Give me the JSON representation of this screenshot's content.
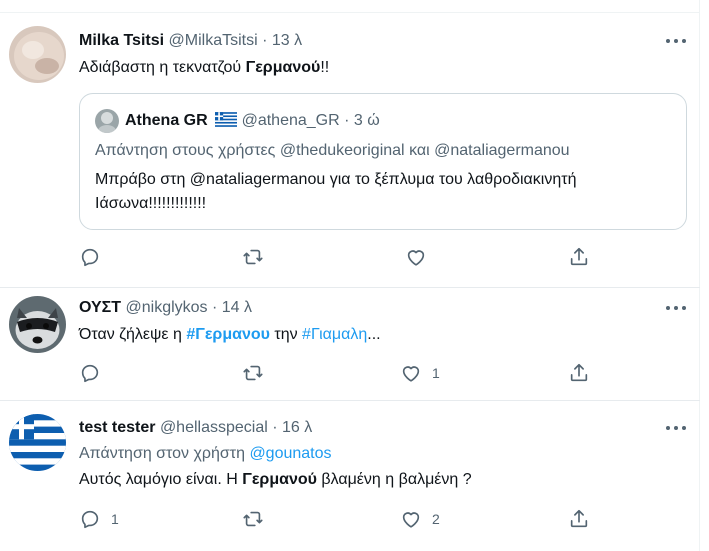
{
  "tweets": [
    {
      "name": "Milka Tsitsi",
      "handle": "@MilkaTsitsi",
      "sep": "·",
      "time": "13 λ",
      "text_before": "Αδιάβαστη η τεκνατζού ",
      "text_bold": "Γερμανού",
      "text_after": "!!",
      "quote": {
        "name": "Athena GR",
        "flag": "greek-flag",
        "handle": "@athena_GR",
        "sep": "·",
        "time": "3 ώ",
        "reply_prefix": "Απάντηση στους χρήστες",
        "reply_user1": "@thedukeoriginal",
        "reply_and": "και",
        "reply_user2": "@nataliagermanou",
        "line1": "Μπράβο στη @nataliagermanou  για το ξέπλυμα του λαθροδιακινητή",
        "line2": "Ιάσωνα!!!!!!!!!!!!!"
      },
      "likes": "",
      "replies": ""
    },
    {
      "name": "ΟΥΣΤ",
      "handle": "@nikglykos",
      "sep": "·",
      "time": "14 λ",
      "text_before": "Όταν ζήλεψε η ",
      "hashtag1": "#Γερμανου",
      "text_mid": " την ",
      "hashtag2": "#Γιαμαλη",
      "text_after": "...",
      "likes": "1",
      "replies": ""
    },
    {
      "name": "test tester",
      "handle": "@hellasspecial",
      "sep": "·",
      "time": "16 λ",
      "reply_prefix": "Απάντηση στον χρήστη",
      "reply_user": "@gounatos",
      "text_before": "Αυτός λαμόγιο είναι. Η ",
      "text_bold": "Γερμανού",
      "text_after": " βλαμένη η βαλμένη ?",
      "likes": "2",
      "replies": "1"
    }
  ],
  "colors": {
    "text": "#0f1419",
    "muted": "#536471",
    "link": "#1d9bf0",
    "border": "#cfd9de"
  },
  "icons": [
    "reply-icon",
    "retweet-icon",
    "like-icon",
    "share-icon",
    "more-icon"
  ]
}
